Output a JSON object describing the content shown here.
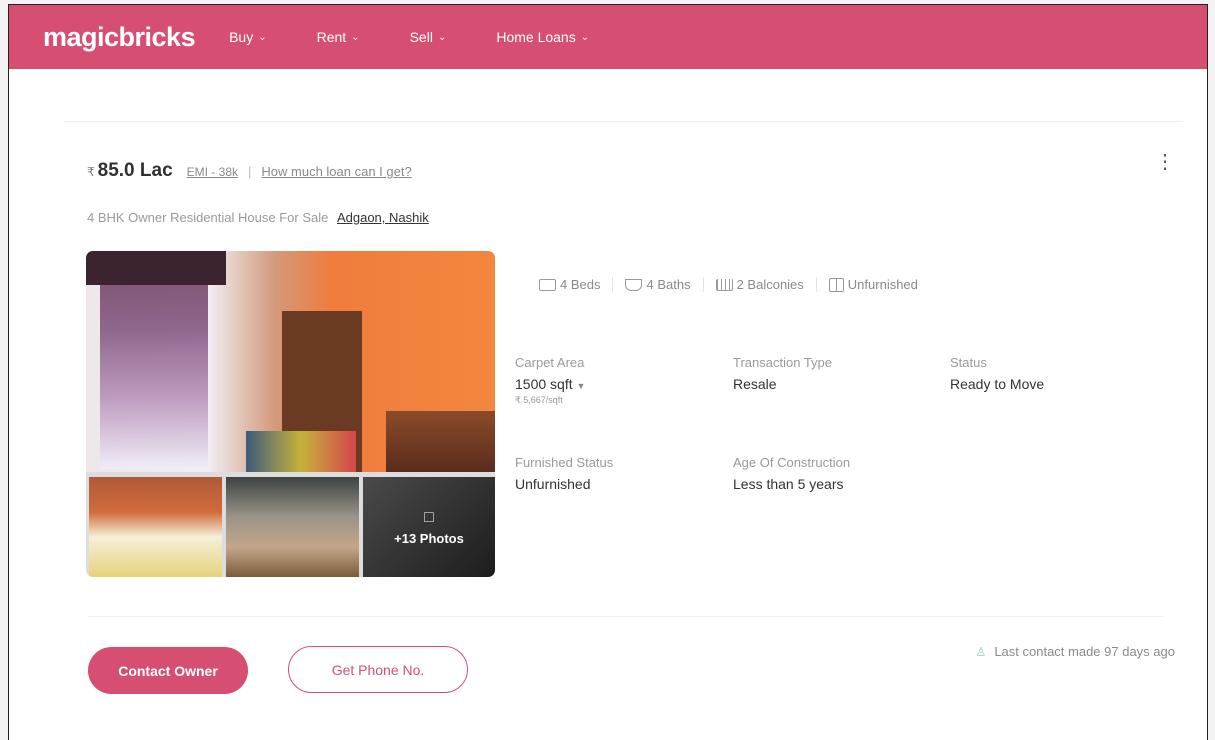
{
  "header": {
    "logo": "magicbricks",
    "nav": [
      {
        "label": "Buy"
      },
      {
        "label": "Rent"
      },
      {
        "label": "Sell"
      },
      {
        "label": "Home Loans"
      }
    ]
  },
  "listing": {
    "price": "85.0 Lac",
    "emi": "EMI - 38k",
    "separator": "|",
    "loan_link": "How much loan can I get?",
    "title": "4 BHK Owner Residential House For Sale",
    "location": "Adgaon, Nashik",
    "photos": {
      "more_label": "+13 Photos"
    },
    "amenities": [
      {
        "label": "4 Beds",
        "icon": "bed-icon"
      },
      {
        "label": "4 Baths",
        "icon": "bath-icon"
      },
      {
        "label": "2 Balconies",
        "icon": "balcony-icon"
      },
      {
        "label": "Unfurnished",
        "icon": "wardrobe-icon"
      }
    ],
    "details": {
      "carpet_area": {
        "label": "Carpet Area",
        "value": "1500 sqft",
        "sub": "5,667/sqft"
      },
      "transaction_type": {
        "label": "Transaction Type",
        "value": "Resale"
      },
      "status": {
        "label": "Status",
        "value": "Ready to Move"
      },
      "furnished_status": {
        "label": "Furnished Status",
        "value": "Unfurnished"
      },
      "age_of_construction": {
        "label": "Age Of Construction",
        "value": "Less than 5 years"
      }
    },
    "actions": {
      "contact_owner": "Contact Owner",
      "get_phone": "Get Phone No."
    },
    "last_contact": "Last contact made 97 days ago"
  },
  "colors": {
    "brand": "#d64f72"
  }
}
